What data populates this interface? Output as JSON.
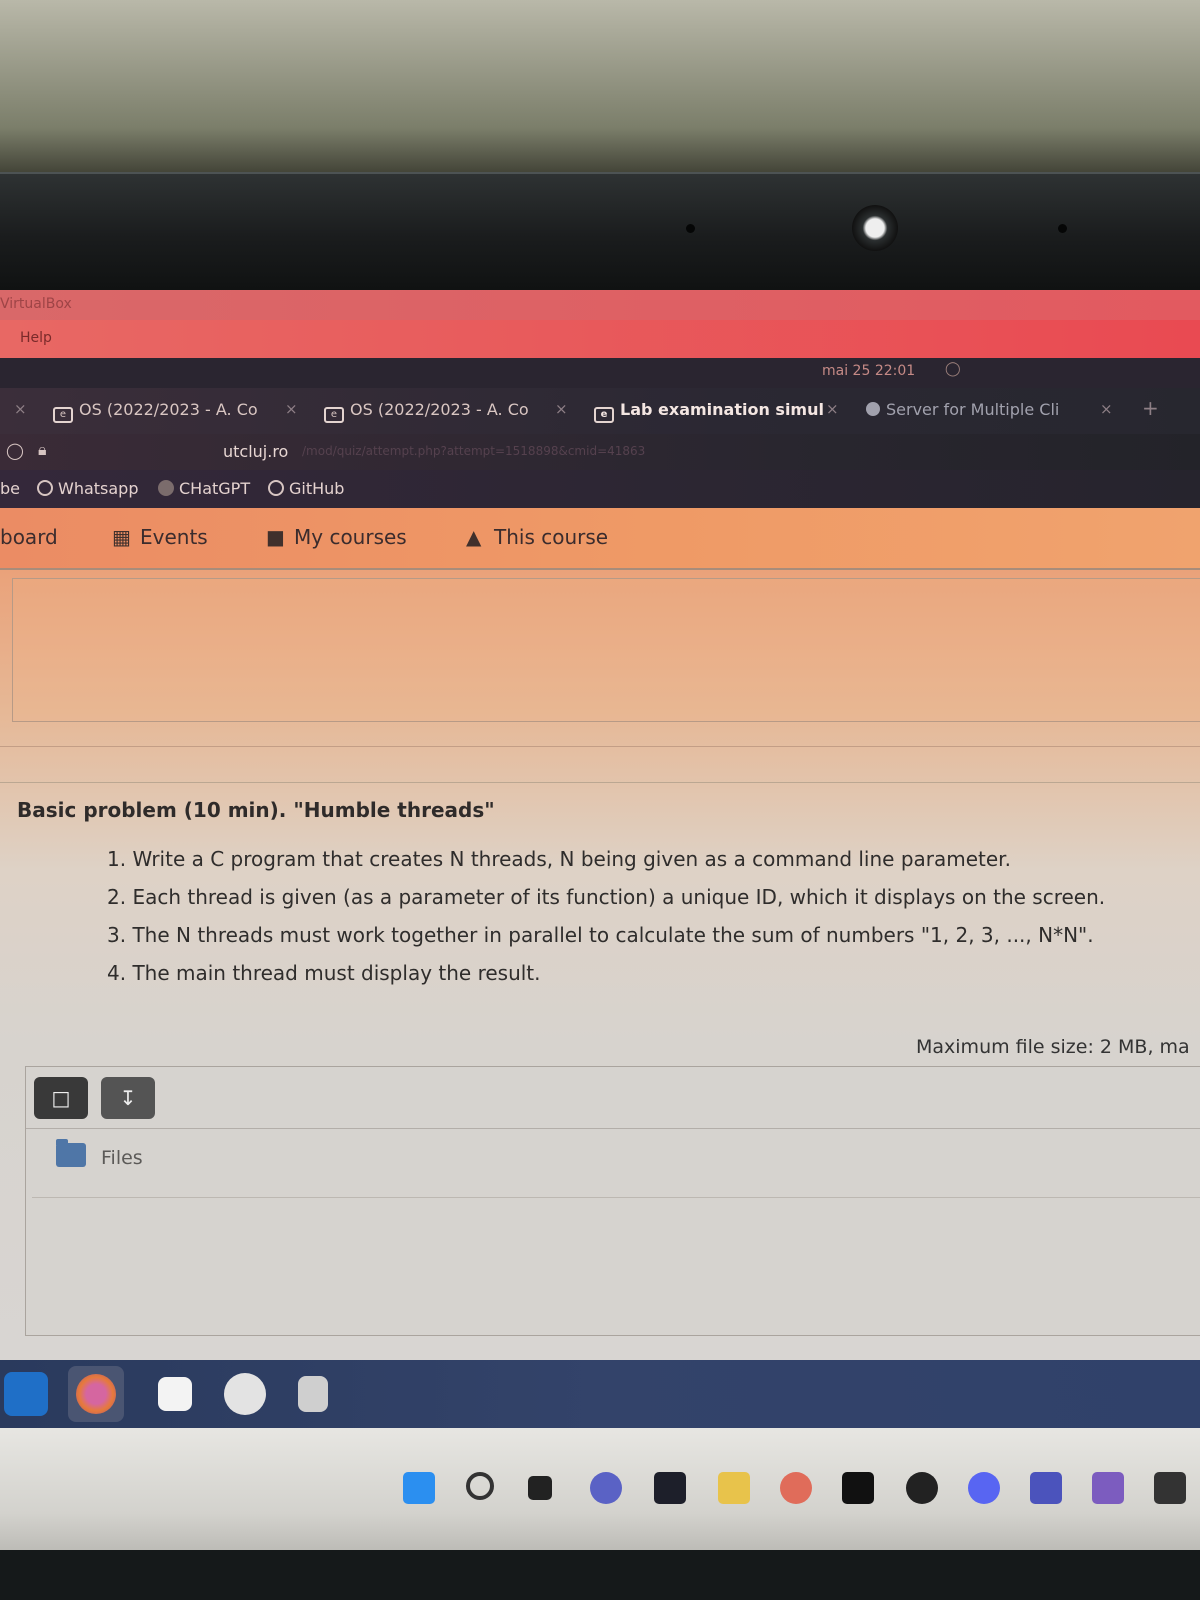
{
  "window": {
    "app_title": "VirtualBox",
    "menu_help": "Help",
    "clock": "mai 25  22:01"
  },
  "tabs": [
    {
      "label": "OS (2022/2023 - A. Co",
      "close": "×"
    },
    {
      "label": "OS (2022/2023 - A. Co",
      "close": "×"
    },
    {
      "label": "Lab examination simul",
      "close": "×"
    },
    {
      "label": "Server for Multiple Cli",
      "close": "×"
    }
  ],
  "new_tab": "+",
  "urlbar": {
    "host": "utcluj.ro",
    "path": "/mod/quiz/attempt.php?attempt=1518898&cmid=41863"
  },
  "bookmarks": [
    {
      "label": "be"
    },
    {
      "label": "Whatsapp"
    },
    {
      "label": "CHatGPT"
    },
    {
      "label": "GitHub"
    }
  ],
  "site_nav": [
    {
      "label": "board",
      "icon": "dashboard-icon"
    },
    {
      "label": "Events",
      "icon": "calendar-icon"
    },
    {
      "label": "My courses",
      "icon": "briefcase-icon"
    },
    {
      "label": "This course",
      "icon": "sitemap-icon"
    }
  ],
  "problem": {
    "title": "Basic problem (10 min). \"Humble threads\"",
    "items": [
      "1. Write a C program that creates N threads, N being given as a command line parameter.",
      "2. Each thread is given (as a parameter of its function) a unique ID, which it displays on the screen.",
      "3. The N threads must work together in parallel to calculate the sum of numbers \"1, 2, 3, ..., N*N\".",
      "4. The main thread must display the result."
    ]
  },
  "upload": {
    "max_size": "Maximum file size: 2 MB, ma",
    "files_label": "Files"
  },
  "colors": {
    "vbox_bar": "#e25a60",
    "browser_dark": "#2b2833",
    "moodle_nav": "#ef9a66",
    "dock": "#33436a"
  }
}
